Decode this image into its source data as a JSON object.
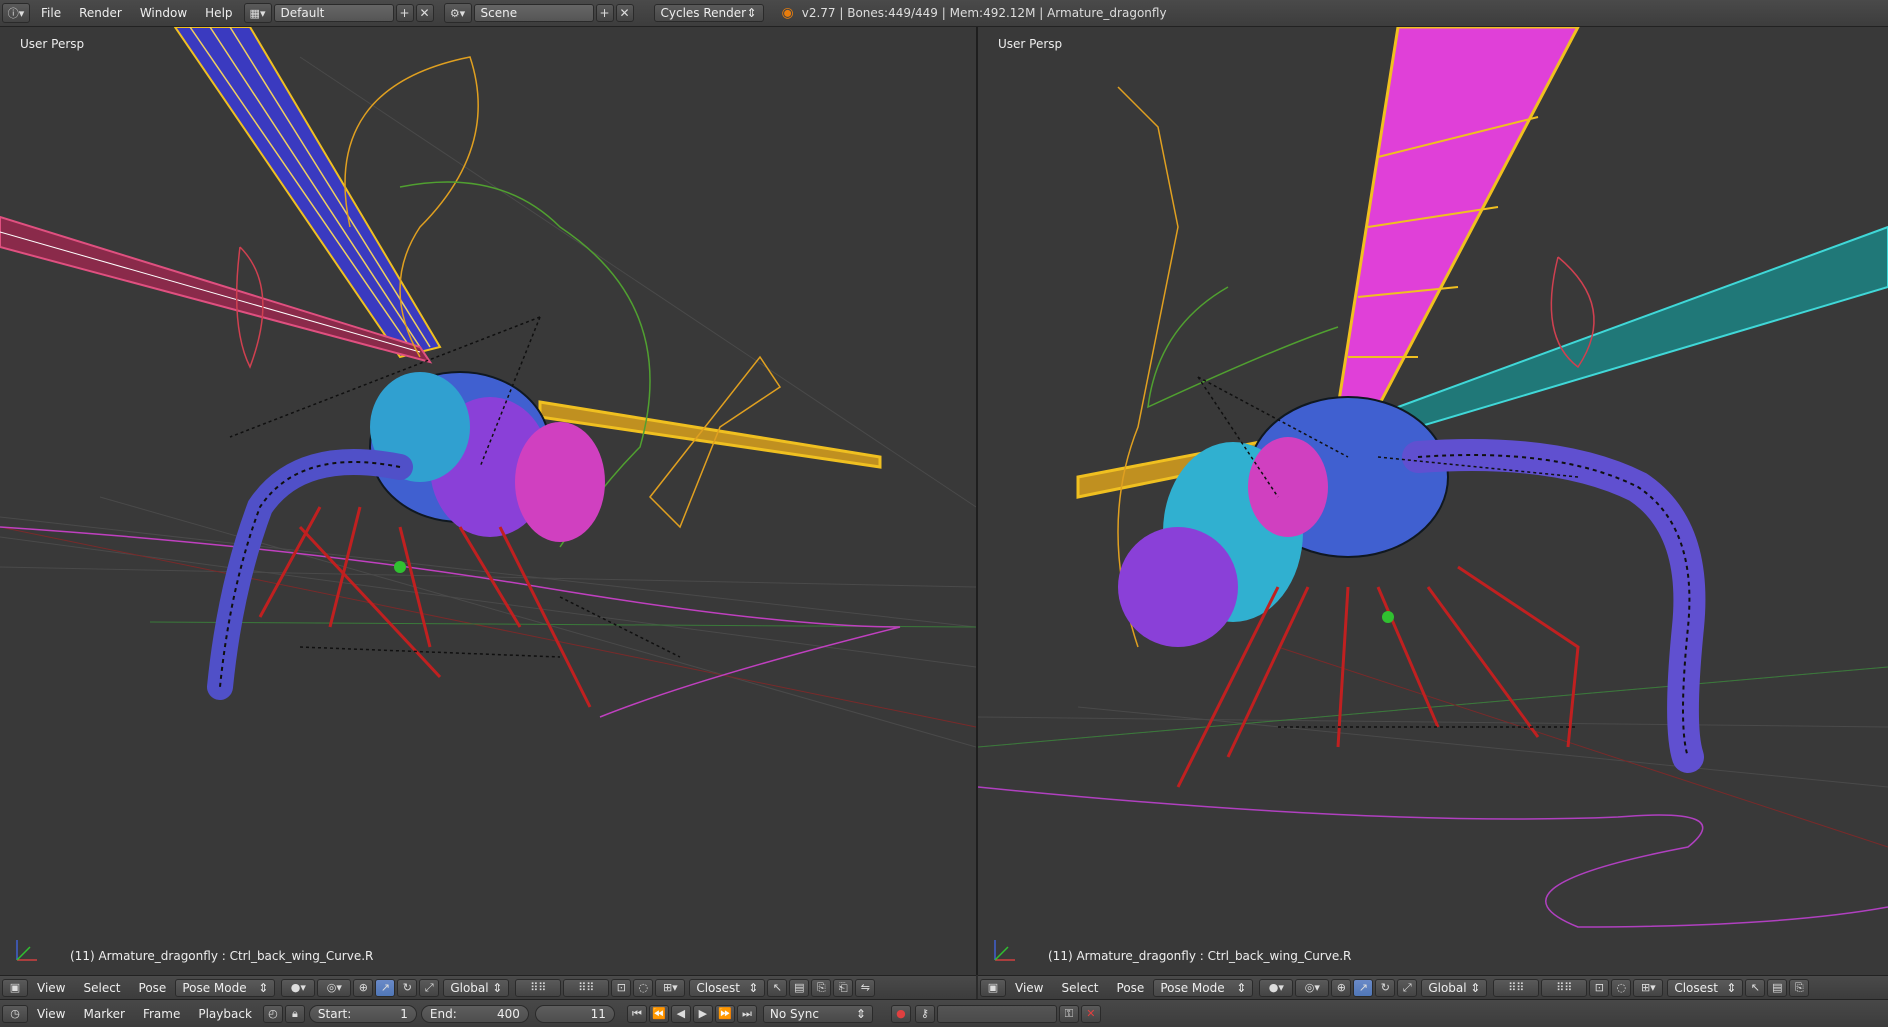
{
  "topbar": {
    "menus": [
      "File",
      "Render",
      "Window",
      "Help"
    ],
    "layout_name": "Default",
    "scene_name": "Scene",
    "render_engine": "Cycles Render",
    "info": "v2.77 | Bones:449/449 | Mem:492.12M | Armature_dragonfly"
  },
  "viewport_left": {
    "persp_label": "User Persp",
    "object_info": "(11) Armature_dragonfly : Ctrl_back_wing_Curve.R"
  },
  "viewport_right": {
    "persp_label": "User Persp",
    "object_info": "(11) Armature_dragonfly : Ctrl_back_wing_Curve.R"
  },
  "header_left": {
    "menus": [
      "View",
      "Select",
      "Pose"
    ],
    "mode": "Pose Mode",
    "orientation": "Global",
    "snap_target": "Closest"
  },
  "header_right": {
    "menus": [
      "View",
      "Select",
      "Pose"
    ],
    "mode": "Pose Mode",
    "orientation": "Global",
    "snap_target": "Closest"
  },
  "timeline": {
    "menus": [
      "View",
      "Marker",
      "Frame",
      "Playback"
    ],
    "start_label": "Start:",
    "start_value": "1",
    "end_label": "End:",
    "end_value": "400",
    "current_frame": "11",
    "sync": "No Sync"
  },
  "colors": {
    "viewport_bg": "#393939",
    "wing_magenta": "#e040d8",
    "wing_yellow": "#f0c020",
    "wing_cyan": "#40d8d8",
    "bone_red": "#c02020"
  }
}
